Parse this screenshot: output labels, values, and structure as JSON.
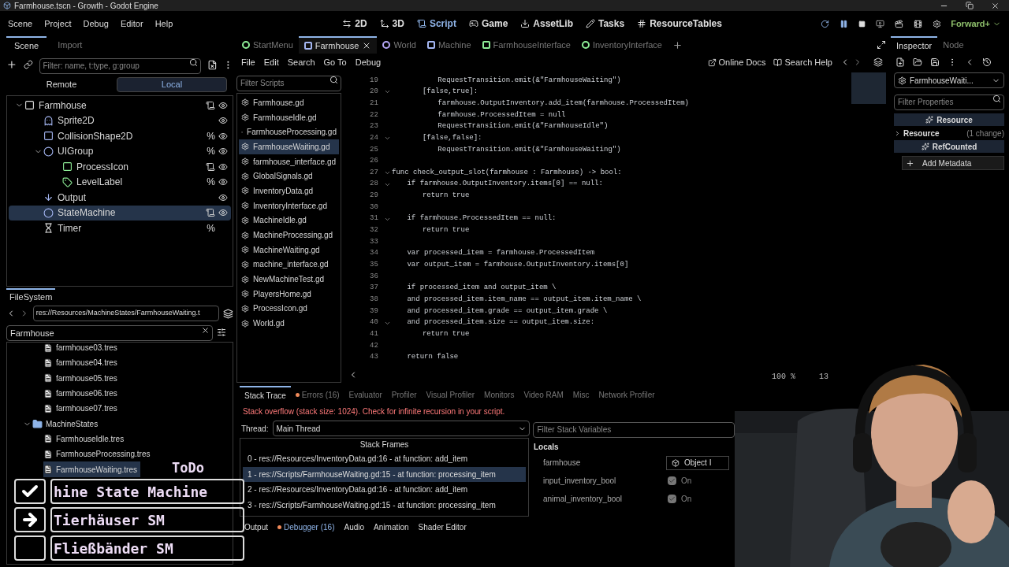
{
  "window": {
    "title": "Farmhouse.tscn - Growth - Godot Engine"
  },
  "menu": [
    "Scene",
    "Project",
    "Debug",
    "Editor",
    "Help"
  ],
  "workspaces": [
    {
      "label": "2D",
      "kind": "twod",
      "selected": false
    },
    {
      "label": "3D",
      "kind": "threed",
      "selected": false
    },
    {
      "label": "Script",
      "kind": "script",
      "selected": true
    },
    {
      "label": "Game",
      "kind": "game",
      "selected": false
    },
    {
      "label": "AssetLib",
      "kind": "assetlib",
      "selected": false
    },
    {
      "label": "Tasks",
      "kind": "tasks",
      "selected": false
    },
    {
      "label": "ResourceTables",
      "kind": "tables",
      "selected": false
    }
  ],
  "renderer": "Forward+",
  "scene_dock": {
    "tabs": [
      {
        "label": "Scene",
        "selected": true
      },
      {
        "label": "Import",
        "selected": false
      }
    ],
    "filter_placeholder": "Filter: name, t:type, g:group",
    "modes": [
      {
        "label": "Remote",
        "selected": false
      },
      {
        "label": "Local",
        "selected": true
      }
    ],
    "tree": [
      {
        "name": "Farmhouse",
        "kind": "scene",
        "expanded": true,
        "selected": false,
        "script": true,
        "visible": true,
        "children": [
          {
            "name": "Sprite2D",
            "kind": "sprite",
            "selected": false,
            "script": false,
            "visible": true
          },
          {
            "name": "CollisionShape2D",
            "kind": "shape",
            "selected": false,
            "script": false,
            "visible": true,
            "unique_mark": "%"
          },
          {
            "name": "UIGroup",
            "kind": "control",
            "expanded": true,
            "selected": false,
            "script": false,
            "visible": true,
            "unique_mark": "%",
            "children": [
              {
                "name": "ProcessIcon",
                "kind": "rect",
                "selected": false,
                "script": true,
                "visible": true
              },
              {
                "name": "LevelLabel",
                "kind": "label",
                "selected": false,
                "script": false,
                "visible": true,
                "unique_mark": "%"
              }
            ]
          },
          {
            "name": "Output",
            "kind": "marker",
            "selected": false,
            "script": false,
            "visible": true
          },
          {
            "name": "StateMachine",
            "kind": "node",
            "selected": true,
            "script": true,
            "visible": true
          },
          {
            "name": "Timer",
            "kind": "timer",
            "selected": false,
            "script": false,
            "visible": false,
            "unique_mark": "%"
          }
        ]
      }
    ]
  },
  "filesystem": {
    "tab": "FileSystem",
    "path": "res://Resources/MachineStates/FarmhouseWaiting.t",
    "search": "Farmhouse",
    "files": [
      {
        "name": "farmhouse03.tres",
        "kind": "file",
        "selected": false
      },
      {
        "name": "farmhouse04.tres",
        "kind": "file",
        "selected": false
      },
      {
        "name": "farmhouse05.tres",
        "kind": "file",
        "selected": false
      },
      {
        "name": "farmhouse06.tres",
        "kind": "file",
        "selected": false
      },
      {
        "name": "farmhouse07.tres",
        "kind": "file",
        "selected": false
      },
      {
        "name": "MachineStates",
        "kind": "folder",
        "selected": false,
        "expanded": true,
        "children": [
          {
            "name": "FarmhouseIdle.tres",
            "kind": "file",
            "selected": false
          },
          {
            "name": "FarmhouseProcessing.tres",
            "kind": "file",
            "selected": false
          },
          {
            "name": "FarmhouseWaiting.tres",
            "kind": "file",
            "selected": true
          }
        ]
      }
    ]
  },
  "script_tabs": [
    {
      "label": "StartMenu",
      "kind": "circle",
      "color": "#8eef97",
      "selected": false
    },
    {
      "label": "Farmhouse",
      "kind": "square",
      "color": "#a5b7f3",
      "selected": true
    },
    {
      "label": "World",
      "kind": "circle",
      "color": "#b3a5f3",
      "selected": false
    },
    {
      "label": "Machine",
      "kind": "square",
      "color": "#a5b7f3",
      "selected": false
    },
    {
      "label": "FarmhouseInterface",
      "kind": "square",
      "color": "#8eef97",
      "selected": false
    },
    {
      "label": "InventoryInterface",
      "kind": "circle",
      "color": "#8eef97",
      "selected": false
    }
  ],
  "script_menu": [
    "File",
    "Edit",
    "Search",
    "Go To",
    "Debug"
  ],
  "help_links": [
    {
      "label": "Online Docs",
      "kind": "docs"
    },
    {
      "label": "Search Help",
      "kind": "help"
    }
  ],
  "scripts": {
    "filter_placeholder": "Filter Scripts",
    "items": [
      {
        "name": "Farmhouse.gd",
        "selected": false
      },
      {
        "name": "FarmhouseIdle.gd",
        "selected": false
      },
      {
        "name": "FarmhouseProcessing.gd",
        "selected": false
      },
      {
        "name": "FarmhouseWaiting.gd",
        "selected": true
      },
      {
        "name": "farmhouse_interface.gd",
        "selected": false
      },
      {
        "name": "GlobalSignals.gd",
        "selected": false
      },
      {
        "name": "InventoryData.gd",
        "selected": false
      },
      {
        "name": "InventoryInterface.gd",
        "selected": false
      },
      {
        "name": "MachineIdle.gd",
        "selected": false
      },
      {
        "name": "MachineProcessing.gd",
        "selected": false
      },
      {
        "name": "MachineWaiting.gd",
        "selected": false
      },
      {
        "name": "machine_interface.gd",
        "selected": false
      },
      {
        "name": "NewMachineTest.gd",
        "selected": false
      },
      {
        "name": "PlayersHome.gd",
        "selected": false
      },
      {
        "name": "ProcessIcon.gd",
        "selected": false
      },
      {
        "name": "World.gd",
        "selected": false
      }
    ]
  },
  "code": {
    "zoom": "100 %",
    "column": "13",
    "lines": [
      {
        "number": "19",
        "text": "\t\t\tRequestTransition.emit(&\"FarmhouseWaiting\")",
        "fold": false
      },
      {
        "number": "20",
        "text": "\t\t[false,true]:",
        "fold": true
      },
      {
        "number": "21",
        "text": "\t\t\tfarmhouse.OutputInventory.add_item(farmhouse.ProcessedItem)",
        "fold": false
      },
      {
        "number": "22",
        "text": "\t\t\tfarmhouse.ProcessedItem = null",
        "fold": false
      },
      {
        "number": "23",
        "text": "\t\t\tRequestTransition.emit(&\"FarmhouseIdle\")",
        "fold": false
      },
      {
        "number": "24",
        "text": "\t\t[false,false]:",
        "fold": true
      },
      {
        "number": "25",
        "text": "\t\t\tRequestTransition.emit(&\"FarmhouseWaiting\")",
        "fold": false
      },
      {
        "number": "26",
        "fold": false
      },
      {
        "number": "27",
        "text": "func check_output_slot(farmhouse : Farmhouse) -> bool:",
        "fold": true
      },
      {
        "number": "28",
        "text": "\tif farmhouse.OutputInventory.items[0] == null:",
        "fold": true
      },
      {
        "number": "29",
        "text": "\t\treturn true",
        "fold": false
      },
      {
        "number": "30",
        "fold": false
      },
      {
        "number": "31",
        "text": "\tif farmhouse.ProcessedItem == null:",
        "fold": true
      },
      {
        "number": "32",
        "text": "\t\treturn true",
        "fold": false
      },
      {
        "number": "33",
        "fold": false
      },
      {
        "number": "34",
        "text": "\tvar processed_item = farmhouse.ProcessedItem",
        "fold": false
      },
      {
        "number": "35",
        "text": "\tvar output_item = farmhouse.OutputInventory.items[0]",
        "fold": false
      },
      {
        "number": "36",
        "fold": false
      },
      {
        "number": "37",
        "text": "\tif processed_item and output_item \\",
        "fold": false
      },
      {
        "number": "38",
        "text": "\tand processed_item.item_name == output_item.item_name \\",
        "fold": false
      },
      {
        "number": "39",
        "text": "\tand processed_item.grade == output_item.grade \\",
        "fold": false
      },
      {
        "number": "40",
        "text": "\tand processed_item.size == output_item.size:",
        "fold": true
      },
      {
        "number": "41",
        "text": "\t\treturn true",
        "fold": false
      },
      {
        "number": "42",
        "fold": false
      },
      {
        "number": "43",
        "text": "\treturn false",
        "fold": false
      }
    ]
  },
  "debugger": {
    "tabs": [
      {
        "label": "Stack Trace",
        "selected": true,
        "errors": false
      },
      {
        "label": "Errors (16)",
        "selected": false,
        "errors": true
      },
      {
        "label": "Evaluator",
        "selected": false,
        "errors": false
      },
      {
        "label": "Profiler",
        "selected": false,
        "errors": false
      },
      {
        "label": "Visual Profiler",
        "selected": false,
        "errors": false
      },
      {
        "label": "Monitors",
        "selected": false,
        "errors": false
      },
      {
        "label": "Video RAM",
        "selected": false,
        "errors": false
      },
      {
        "label": "Misc",
        "selected": false,
        "errors": false
      },
      {
        "label": "Network Profiler",
        "selected": false,
        "errors": false
      }
    ],
    "message": "Stack overflow (stack size: 1024). Check for infinite recursion in your script.",
    "thread_label": "Thread:",
    "thread": "Main Thread",
    "filter_placeholder": "Filter Stack Variables",
    "frames_title": "Stack Frames",
    "frames": [
      {
        "text": "0 - res://Resources/InventoryData.gd:16 - at function: add_item",
        "selected": false
      },
      {
        "text": "1 - res://Scripts/FarmhouseWaiting.gd:15 - at function: processing_item",
        "selected": true
      },
      {
        "text": "2 - res://Resources/InventoryData.gd:16 - at function: add_item",
        "selected": false
      },
      {
        "text": "3 - res://Scripts/FarmhouseWaiting.gd:15 - at function: processing_item",
        "selected": false
      }
    ],
    "locals_title": "Locals",
    "locals": [
      {
        "name": "farmhouse",
        "kind": "object",
        "value": "Object I"
      },
      {
        "name": "input_inventory_bool",
        "kind": "bool",
        "value": "On",
        "checked": true
      },
      {
        "name": "animal_inventory_bool",
        "kind": "bool",
        "value": "On",
        "checked": true
      }
    ]
  },
  "bottom_tabs": [
    {
      "label": "Output",
      "selected": false,
      "errors": false
    },
    {
      "label": "Debugger (16)",
      "selected": true,
      "errors": true
    },
    {
      "label": "Audio",
      "selected": false,
      "errors": false
    },
    {
      "label": "Animation",
      "selected": false,
      "errors": false
    },
    {
      "label": "Shader Editor",
      "selected": false,
      "errors": false
    }
  ],
  "inspector": {
    "tabs": [
      {
        "label": "Inspector",
        "selected": true
      },
      {
        "label": "Node",
        "selected": false
      }
    ],
    "resource": "FarmhouseWaiti...",
    "filter_placeholder": "Filter Properties",
    "sections": [
      {
        "kind": "header",
        "label": "Resource"
      },
      {
        "kind": "category",
        "label": "Resource",
        "note": "(1 change)"
      },
      {
        "kind": "header",
        "label": "RefCounted"
      }
    ],
    "add_button": "Add Metadata"
  },
  "todo": {
    "title": "ToDo",
    "items": [
      {
        "text": "hine State Machine",
        "kind": "done"
      },
      {
        "text": "Tierhäuser SM",
        "kind": "current"
      },
      {
        "text": "Fließbänder SM",
        "kind": "pending"
      }
    ]
  },
  "webcam": {
    "kind": "picture"
  }
}
